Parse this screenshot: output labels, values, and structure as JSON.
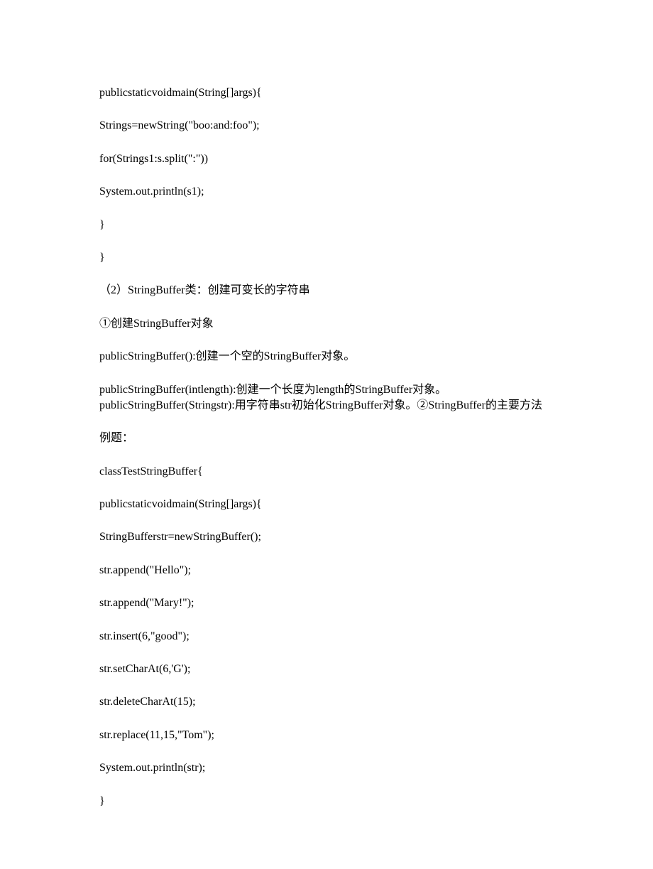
{
  "lines": [
    "publicstaticvoidmain(String[]args){",
    "Strings=newString(\"boo:and:foo\");",
    "for(Strings1:s.split(\":\"))",
    "System.out.println(s1);",
    "}",
    "}",
    "（2）StringBuffer类：创建可变长的字符串",
    "①创建StringBuffer对象",
    "publicStringBuffer():创建一个空的StringBuffer对象。",
    "publicStringBuffer(intlength):创建一个长度为length的StringBuffer对象。publicStringBuffer(Stringstr):用字符串str初始化StringBuffer对象。②StringBuffer的主要方法",
    "例题：",
    "classTestStringBuffer{",
    "publicstaticvoidmain(String[]args){",
    "StringBufferstr=newStringBuffer();",
    "str.append(\"Hello\");",
    "str.append(\"Mary!\");",
    "str.insert(6,\"good\");",
    "str.setCharAt(6,'G');",
    "str.deleteCharAt(15);",
    "str.replace(11,15,\"Tom\");",
    "System.out.println(str);",
    "}"
  ]
}
